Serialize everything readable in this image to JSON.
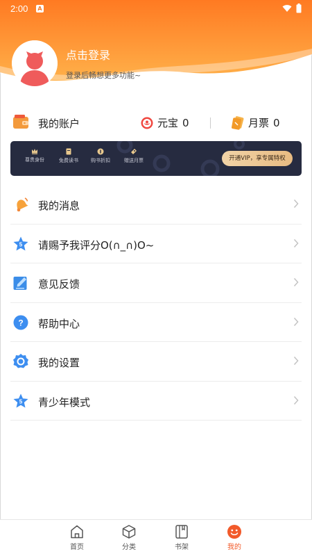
{
  "status": {
    "time": "2:00",
    "notif": "A"
  },
  "colors": {
    "accent": "#f25a2a",
    "header_top": "#ff7a22",
    "header_bottom": "#ffb14a",
    "vip_bg": "#262b40"
  },
  "profile": {
    "title": "点击登录",
    "subtitle": "登录后畅想更多功能~"
  },
  "account": {
    "label": "我的账户",
    "yuanbao_label": "元宝",
    "yuanbao_value": "0",
    "yuepiao_label": "月票",
    "yuepiao_value": "0"
  },
  "vip": {
    "perks": [
      {
        "icon": "crown-icon",
        "label": "尊贵身份"
      },
      {
        "icon": "book-icon",
        "label": "免费读书"
      },
      {
        "icon": "coin-icon",
        "label": "购书折扣"
      },
      {
        "icon": "ticket-icon",
        "label": "赠送月票"
      }
    ],
    "button_label": "开通VIP，享专属特权"
  },
  "menu": [
    {
      "icon": "bell-icon",
      "label": "我的消息"
    },
    {
      "icon": "star-rating-icon",
      "label": "请赐予我评分O(∩_∩)O~"
    },
    {
      "icon": "feedback-icon",
      "label": "意见反馈"
    },
    {
      "icon": "help-icon",
      "label": "帮助中心"
    },
    {
      "icon": "settings-icon",
      "label": "我的设置"
    },
    {
      "icon": "youth-mode-icon",
      "label": "青少年模式"
    }
  ],
  "nav": [
    {
      "icon": "home-icon",
      "label": "首页"
    },
    {
      "icon": "category-icon",
      "label": "分类"
    },
    {
      "icon": "bookshelf-icon",
      "label": "书架"
    },
    {
      "icon": "profile-icon",
      "label": "我的",
      "active": true
    }
  ]
}
